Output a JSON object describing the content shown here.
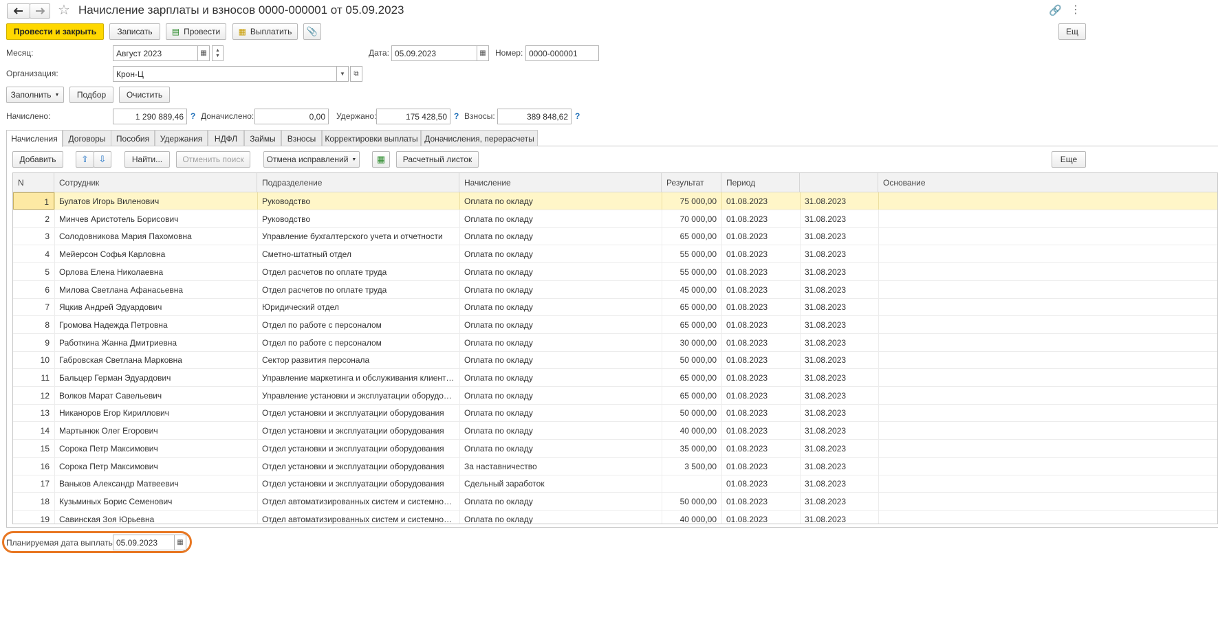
{
  "title": "Начисление зарплаты и взносов 0000-000001 от 05.09.2023",
  "icons": {
    "back": "arrow-left-icon",
    "forward": "arrow-right-icon",
    "star": "star-icon",
    "link": "link-icon",
    "more": "vertical-dots-icon",
    "calendar": "calendar-icon",
    "clip": "paperclip-icon"
  },
  "toolbar": {
    "post_close": "Провести и закрыть",
    "save": "Записать",
    "post": "Провести",
    "pay": "Выплатить",
    "more": "Ещ"
  },
  "form": {
    "month_label": "Месяц:",
    "month_value": "Август 2023",
    "date_label": "Дата:",
    "date_value": "05.09.2023",
    "number_label": "Номер:",
    "number_value": "0000-000001",
    "org_label": "Организация:",
    "org_value": "Крон-Ц",
    "fill": "Заполнить",
    "pick": "Подбор",
    "clear": "Очистить",
    "accrued_label": "Начислено:",
    "accrued_value": "1 290 889,46",
    "extra_label": "Доначислено:",
    "extra_value": "0,00",
    "withheld_label": "Удержано:",
    "withheld_value": "175 428,50",
    "contrib_label": "Взносы:",
    "contrib_value": "389 848,62",
    "q": "?"
  },
  "tabs": [
    "Начисления",
    "Договоры",
    "Пособия",
    "Удержания",
    "НДФЛ",
    "Займы",
    "Взносы",
    "Корректировки выплаты",
    "Доначисления, перерасчеты"
  ],
  "tabbar": {
    "add": "Добавить",
    "find": "Найти...",
    "cancel_search": "Отменить поиск",
    "cancel_fix": "Отмена исправлений",
    "payslip": "Расчетный листок",
    "more": "Еще"
  },
  "table": {
    "headers": [
      "N",
      "Сотрудник",
      "Подразделение",
      "Начисление",
      "Результат",
      "Период",
      "",
      "Основание"
    ],
    "rows": [
      [
        "1",
        "Булатов Игорь Виленович",
        "Руководство",
        "Оплата по окладу",
        "75 000,00",
        "01.08.2023",
        "31.08.2023"
      ],
      [
        "2",
        "Минчев Аристотель Борисович",
        "Руководство",
        "Оплата по окладу",
        "70 000,00",
        "01.08.2023",
        "31.08.2023"
      ],
      [
        "3",
        "Солодовникова Мария Пахомовна",
        "Управление бухгалтерского учета и отчетности",
        "Оплата по окладу",
        "65 000,00",
        "01.08.2023",
        "31.08.2023"
      ],
      [
        "4",
        "Мейерсон Софья Карловна",
        "Сметно-штатный отдел",
        "Оплата по окладу",
        "55 000,00",
        "01.08.2023",
        "31.08.2023"
      ],
      [
        "5",
        "Орлова Елена Николаевна",
        "Отдел расчетов по оплате труда",
        "Оплата по окладу",
        "55 000,00",
        "01.08.2023",
        "31.08.2023"
      ],
      [
        "6",
        "Милова Светлана Афанасьевна",
        "Отдел расчетов по оплате труда",
        "Оплата по окладу",
        "45 000,00",
        "01.08.2023",
        "31.08.2023"
      ],
      [
        "7",
        "Яцкив Андрей Эдуардович",
        "Юридический отдел",
        "Оплата по окладу",
        "65 000,00",
        "01.08.2023",
        "31.08.2023"
      ],
      [
        "8",
        "Громова Надежда Петровна",
        "Отдел по работе с персоналом",
        "Оплата по окладу",
        "65 000,00",
        "01.08.2023",
        "31.08.2023"
      ],
      [
        "9",
        "Работкина Жанна Дмитриевна",
        "Отдел по работе с персоналом",
        "Оплата по окладу",
        "30 000,00",
        "01.08.2023",
        "31.08.2023"
      ],
      [
        "10",
        "Габровская Светлана Марковна",
        "Сектор развития персонала",
        "Оплата по окладу",
        "50 000,00",
        "01.08.2023",
        "31.08.2023"
      ],
      [
        "11",
        "Бальцер Герман Эдуардович",
        "Управление маркетинга и обслуживания клиентов",
        "Оплата по окладу",
        "65 000,00",
        "01.08.2023",
        "31.08.2023"
      ],
      [
        "12",
        "Волков Марат Савельевич",
        "Управление установки и эксплуатации оборудова...",
        "Оплата по окладу",
        "65 000,00",
        "01.08.2023",
        "31.08.2023"
      ],
      [
        "13",
        "Никаноров Егор Кириллович",
        "Отдел установки и эксплуатации оборудования",
        "Оплата по окладу",
        "50 000,00",
        "01.08.2023",
        "31.08.2023"
      ],
      [
        "14",
        "Мартынюк Олег Егорович",
        "Отдел установки и эксплуатации оборудования",
        "Оплата по окладу",
        "40 000,00",
        "01.08.2023",
        "31.08.2023"
      ],
      [
        "15",
        "Сорока Петр Максимович",
        "Отдел установки и эксплуатации оборудования",
        "Оплата по окладу",
        "35 000,00",
        "01.08.2023",
        "31.08.2023"
      ],
      [
        "16",
        "Сорока Петр Максимович",
        "Отдел установки и эксплуатации оборудования",
        "За наставничество",
        "3 500,00",
        "01.08.2023",
        "31.08.2023"
      ],
      [
        "17",
        "Ваньков Александр Матвеевич",
        "Отдел установки и эксплуатации оборудования",
        "Сдельный заработок",
        "",
        "01.08.2023",
        "31.08.2023"
      ],
      [
        "18",
        "Кузьминых Борис Семенович",
        "Отдел автоматизированных систем и системного ...",
        "Оплата по окладу",
        "50 000,00",
        "01.08.2023",
        "31.08.2023"
      ],
      [
        "19",
        "Савинская Зоя Юрьевна",
        "Отдел автоматизированных систем и системного ...",
        "Оплата по окладу",
        "40 000,00",
        "01.08.2023",
        "31.08.2023"
      ]
    ]
  },
  "footer": {
    "planned_label": "Планируемая дата выплаты:",
    "planned_value": "05.09.2023"
  },
  "colors": {
    "primary": "#ffd800",
    "selected_row": "#fff6c8",
    "highlight": "#e87722",
    "help": "#1f6fb8"
  }
}
